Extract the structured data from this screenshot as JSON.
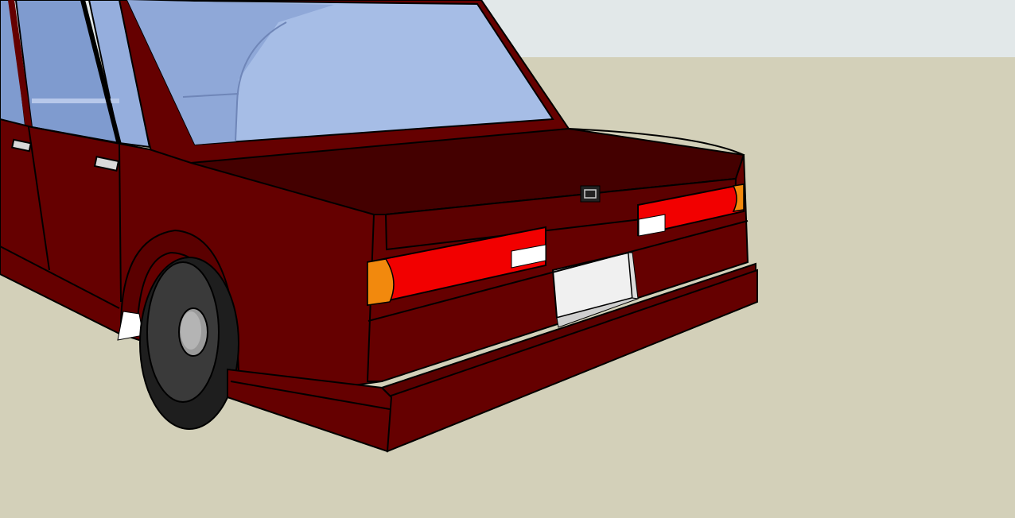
{
  "scene": {
    "subject": "car-rear-3d-model",
    "colors": {
      "sky": "#dfe5e6",
      "ground": "#d3d0b9",
      "body": "#650000",
      "body_top": "#440000",
      "body_shadow": "#5a0000",
      "glass": "#a6bde6",
      "glass_dark": "#7f9bcf",
      "tail_light": "#f20000",
      "turn_signal": "#f2890d",
      "reverse_light": "#ffffff",
      "plate": "#f0f0f0",
      "tire": "#1e1e1e",
      "rim": "#9a9a9a",
      "outline": "#000000"
    }
  }
}
